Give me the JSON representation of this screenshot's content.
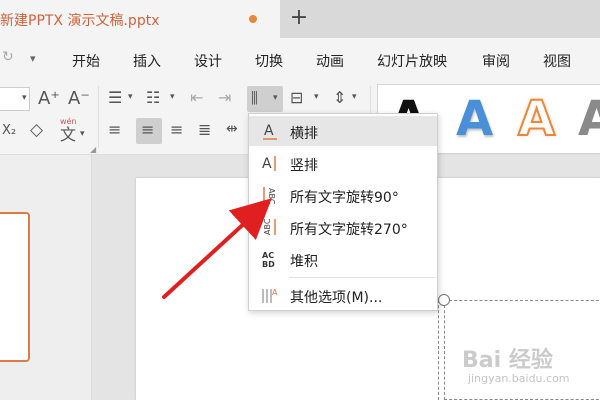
{
  "document_tab": {
    "title": "新建PPTX 演示文稿.pptx"
  },
  "new_tab_symbol": "+",
  "menu": {
    "items": [
      "开始",
      "插入",
      "设计",
      "切换",
      "动画",
      "幻灯片放映",
      "审阅",
      "视图"
    ]
  },
  "ribbon": {
    "grow_font": "A⁺",
    "shrink_font": "A⁻",
    "phonetic_label": "wén",
    "phonetic_char": "文"
  },
  "text_direction_menu": {
    "items": [
      {
        "label": "横排",
        "icon": "horizontal-text-icon"
      },
      {
        "label": "竖排",
        "icon": "vertical-text-icon"
      },
      {
        "label": "所有文字旋转90°",
        "icon": "rotate-90-icon"
      },
      {
        "label": "所有文字旋转270°",
        "icon": "rotate-270-icon"
      },
      {
        "label": "堆积",
        "icon": "stacked-text-icon"
      },
      {
        "label": "其他选项(M)...",
        "icon": "more-options-icon"
      }
    ]
  },
  "style_gallery": {
    "samples": [
      {
        "glyph": "A",
        "style": "black"
      },
      {
        "glyph": "A",
        "style": "blue-gradient"
      },
      {
        "glyph": "A",
        "style": "orange-outline"
      },
      {
        "glyph": "A",
        "style": "gray"
      }
    ]
  },
  "colors": {
    "accent_orange": "#d0623a",
    "arrow_red": "#e02020",
    "gallery_blue": "#4a90d8",
    "gallery_orange": "#e9883d"
  }
}
